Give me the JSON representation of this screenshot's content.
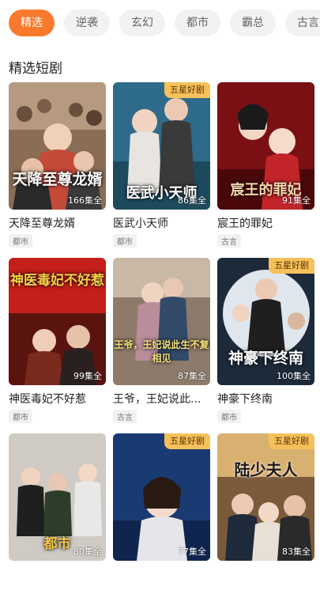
{
  "tabs": [
    "精选",
    "逆袭",
    "玄幻",
    "都市",
    "霸总",
    "古言"
  ],
  "section_title": "精选短剧",
  "badge_label": "五星好剧",
  "dramas": [
    {
      "name": "天降至尊龙婿",
      "tag": "都市",
      "episodes": "166集全",
      "poster_text": "天降至尊龙婿",
      "badge": ""
    },
    {
      "name": "医武小天师",
      "tag": "都市",
      "episodes": "86集全",
      "poster_text": "医武小天师",
      "badge": "五星好剧"
    },
    {
      "name": "宸王的罪妃",
      "tag": "古言",
      "episodes": "91集全",
      "poster_text": "宸王的罪妃",
      "badge": ""
    },
    {
      "name": "神医毒妃不好惹",
      "tag": "都市",
      "episodes": "99集全",
      "poster_text": "神医毒妃不好惹",
      "badge": ""
    },
    {
      "name": "王爷，王妃说此...",
      "tag": "古言",
      "episodes": "87集全",
      "poster_text": "王爷，王妃说此生不复相见",
      "badge": ""
    },
    {
      "name": "神豪下终南",
      "tag": "都市",
      "episodes": "100集全",
      "poster_text": "神豪下终南",
      "badge": "五星好剧"
    },
    {
      "name": "",
      "tag": "",
      "episodes": "80集全",
      "poster_text": "都市",
      "badge": ""
    },
    {
      "name": "",
      "tag": "",
      "episodes": "77集全",
      "poster_text": "",
      "badge": "五星好剧"
    },
    {
      "name": "",
      "tag": "",
      "episodes": "83集全",
      "poster_text": "陆少夫人",
      "badge": "五星好剧"
    }
  ],
  "colors": {
    "accent": "#f97a2c",
    "badge": "#f6c15a"
  }
}
